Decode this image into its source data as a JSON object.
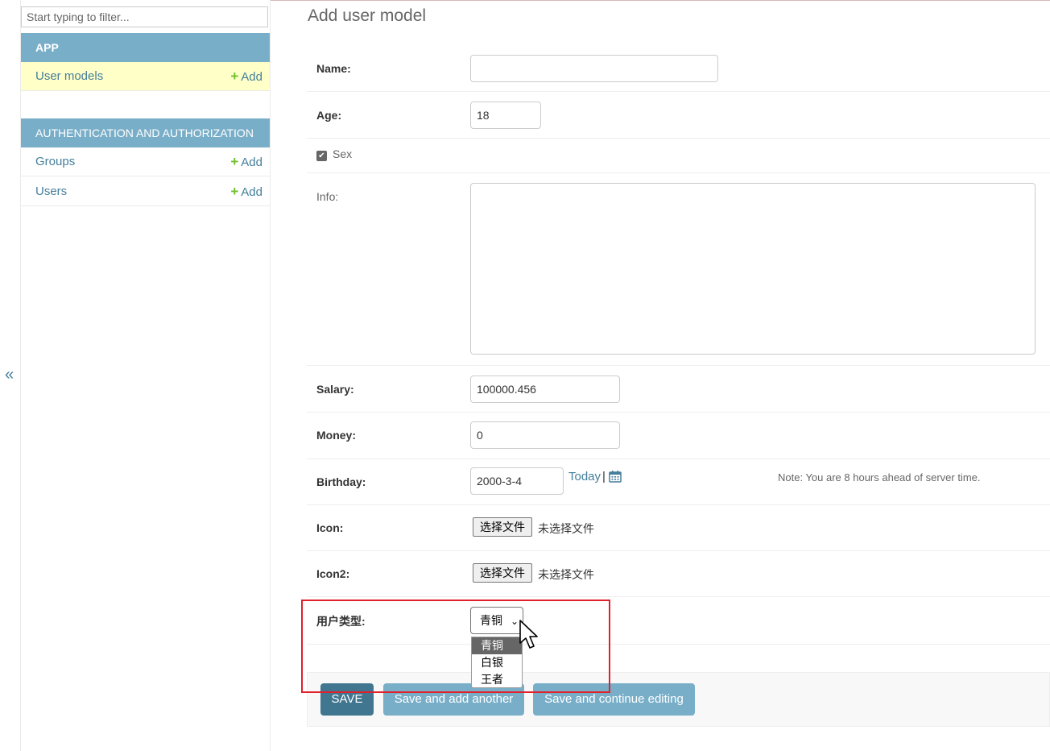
{
  "sidebar": {
    "filter_placeholder": "Start typing to filter...",
    "collapse_label": "«",
    "app_caption": "APP",
    "auth_caption": "AUTHENTICATION AND AUTHORIZATION",
    "items": [
      {
        "label": "User models",
        "add_label": "Add"
      },
      {
        "label": "Groups",
        "add_label": "Add"
      },
      {
        "label": "Users",
        "add_label": "Add"
      }
    ],
    "plus_glyph": "+"
  },
  "main": {
    "title": "Add user model",
    "fields": {
      "name": {
        "label": "Name:",
        "value": ""
      },
      "age": {
        "label": "Age:",
        "value": "18"
      },
      "sex": {
        "label": "Sex",
        "checked": true,
        "check_glyph": "✔"
      },
      "info": {
        "label": "Info:",
        "value": ""
      },
      "salary": {
        "label": "Salary:",
        "value": "100000.456"
      },
      "money": {
        "label": "Money:",
        "value": "0"
      },
      "birthday": {
        "label": "Birthday:",
        "value": "2000-3-4",
        "today_label": "Today",
        "separator": "|",
        "note": "Note: You are 8 hours ahead of server time."
      },
      "icon": {
        "label": "Icon:",
        "button": "选择文件",
        "status": "未选择文件"
      },
      "icon2": {
        "label": "Icon2:",
        "button": "选择文件",
        "status": "未选择文件"
      },
      "user_type": {
        "label": "用户类型:",
        "selected": "青铜",
        "options": [
          "青铜",
          "白银",
          "王者"
        ],
        "chevron": "⌄"
      }
    },
    "buttons": {
      "save": "SAVE",
      "save_add_another": "Save and add another",
      "save_continue": "Save and continue editing"
    }
  },
  "colors": {
    "module_caption": "#79aec8",
    "active_row": "#ffffc8",
    "link": "#447e9b",
    "add_plus": "#70bf2b",
    "save_button": "#417690",
    "secondary_button": "#79aec8",
    "highlight_box": "#e0202a"
  }
}
